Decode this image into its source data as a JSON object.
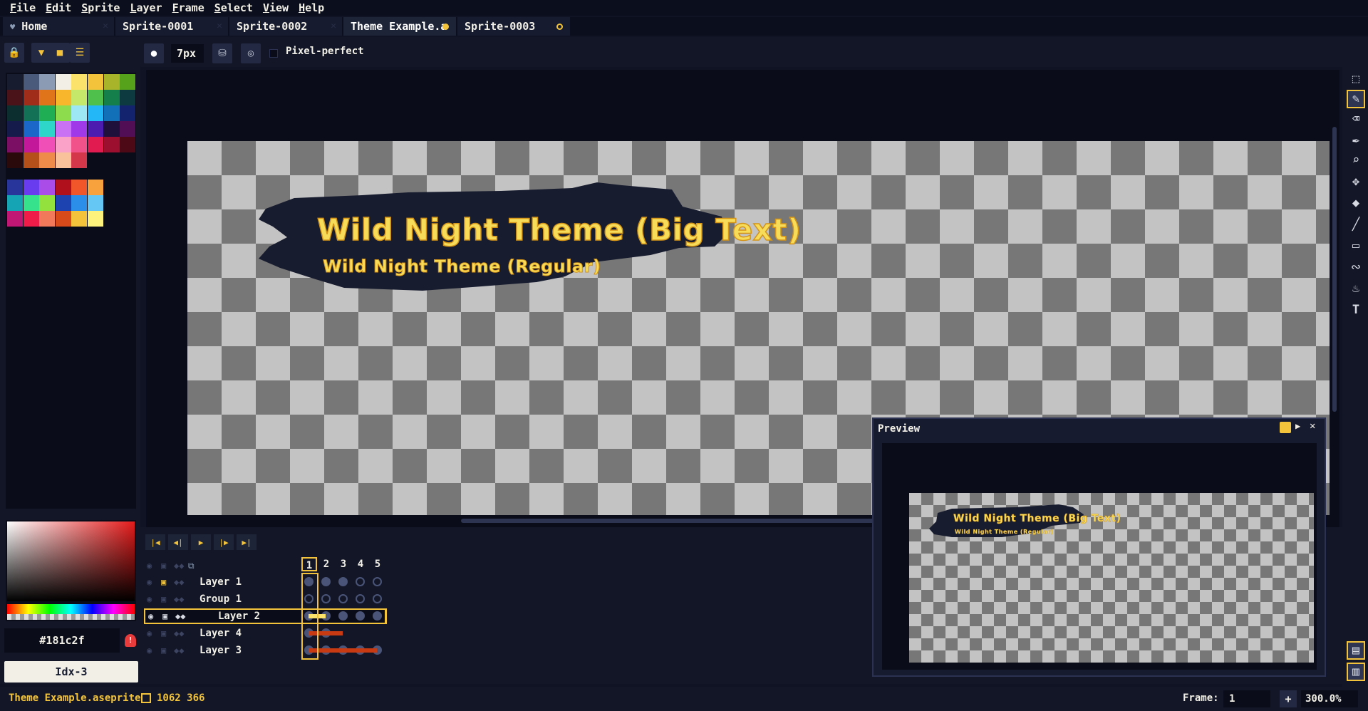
{
  "menu": [
    "File",
    "Edit",
    "Sprite",
    "Layer",
    "Frame",
    "Select",
    "View",
    "Help"
  ],
  "tabs": [
    {
      "label": "Home",
      "icon": "heart-icon"
    },
    {
      "label": "Sprite-0001"
    },
    {
      "label": "Sprite-0002"
    },
    {
      "label": "Theme Example.a",
      "active": true,
      "modified": true
    },
    {
      "label": "Sprite-0003",
      "modified": true
    }
  ],
  "tool_options": {
    "brush_size": "7px",
    "pixel_perfect_label": "Pixel-perfect",
    "pixel_perfect_checked": false
  },
  "canvas_text": {
    "big": "Wild Night Theme (Big Text)",
    "regular": "Wild Night Theme (Regular)"
  },
  "color": {
    "hex": "#181c2f",
    "index": "Idx-3",
    "accent": "#f3c43b"
  },
  "palette": [
    "#181c2f",
    "#4a5a7a",
    "#8b9bb4",
    "#f2f0e6",
    "#fbe36b",
    "#f3c43b",
    "#a8b42a",
    "#57a21b",
    "#4a1219",
    "#a02c1a",
    "#e0741b",
    "#f7b62c",
    "#c5e86b",
    "#4ec04b",
    "#157f4c",
    "#0d3a40",
    "#0c2e2e",
    "#137255",
    "#1fae53",
    "#8ddc4e",
    "#9de6f4",
    "#24b7f7",
    "#1170b8",
    "#13236e",
    "#151b4a",
    "#1b66c9",
    "#2dd6c8",
    "#c973f4",
    "#a03ae8",
    "#4c1cb0",
    "#1e103a",
    "#520e55",
    "#7b0f63",
    "#c3189a",
    "#f04fb7",
    "#fba2c9",
    "#f2528a",
    "#e11b4f",
    "#9c0f2e",
    "#4d0a16",
    "#2a0a0a",
    "#b6501b",
    "#ee8a4a",
    "#f9c29a",
    "#d4374a"
  ],
  "palette2": [
    "#28359b",
    "#6a3cf0",
    "#a94ce8",
    "#b0101b",
    "#f1562a",
    "#f7a23c",
    "#14a4b4",
    "#36e28c",
    "#92e13c",
    "#1d43b0",
    "#2b8ee8",
    "#65c8f4",
    "#c01674",
    "#ef1c4a",
    "#f27a5a",
    "#d84a1a",
    "#f3c43b",
    "#fdf37c"
  ],
  "timeline": {
    "frames": [
      "1",
      "2",
      "3",
      "4",
      "5"
    ],
    "layers": [
      {
        "name": "Layer 1",
        "indent": 0
      },
      {
        "name": "Group 1",
        "indent": 0
      },
      {
        "name": "Layer 2",
        "indent": 1,
        "selected": true
      },
      {
        "name": "Layer 4",
        "indent": 0
      },
      {
        "name": "Layer 3",
        "indent": 0
      }
    ]
  },
  "preview": {
    "title": "Preview"
  },
  "status": {
    "filename": "Theme Example.aseprite",
    "coords": "1062 366",
    "frame_label": "Frame:",
    "frame_value": "1",
    "plus": "+",
    "zoom": "300.0%"
  },
  "right_tools": [
    "rect-marquee-icon",
    "pencil-icon",
    "eraser-icon",
    "eyedropper-icon",
    "zoom-icon",
    "move-icon",
    "paint-bucket-icon",
    "line-icon",
    "rectangle-icon",
    "contour-icon",
    "blur-icon",
    "text-icon"
  ]
}
